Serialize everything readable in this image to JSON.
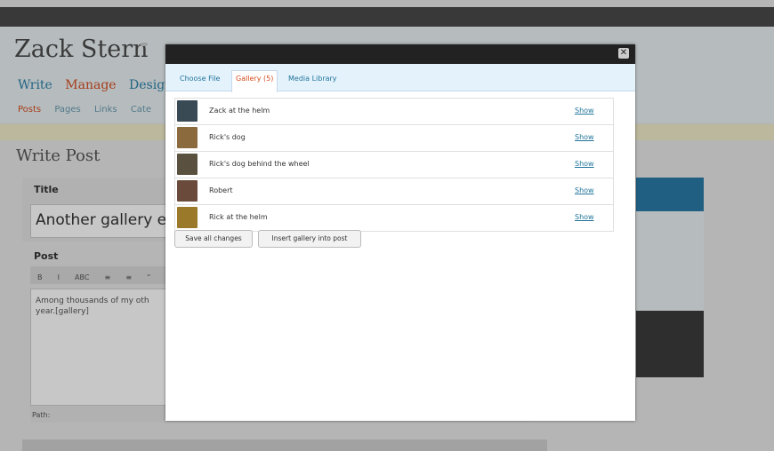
{
  "background": {
    "site_title": "Zack Stern",
    "main_nav": [
      "Write",
      "Manage",
      "Design"
    ],
    "main_nav_current": "Manage",
    "sub_nav": [
      "Posts",
      "Pages",
      "Links",
      "Cate"
    ],
    "page_heading": "Write Post",
    "title_label": "Title",
    "title_value": "Another gallery e",
    "post_label": "Post",
    "editor_text": "Among thousands of my oth year.[gallery]",
    "path_label": "Path:"
  },
  "modal": {
    "tabs": [
      {
        "label": "Choose File",
        "active": false
      },
      {
        "label": "Gallery (5)",
        "active": true
      },
      {
        "label": "Media Library",
        "active": false
      }
    ],
    "gallery": [
      {
        "title": "Zack at the helm",
        "action": "Show",
        "thumb_color": "#3a4a55"
      },
      {
        "title": "Rick's dog",
        "action": "Show",
        "thumb_color": "#8b6a3e"
      },
      {
        "title": "Rick's dog behind the wheel",
        "action": "Show",
        "thumb_color": "#5a5040"
      },
      {
        "title": "Robert",
        "action": "Show",
        "thumb_color": "#6a4a3a"
      },
      {
        "title": "Rick at the helm",
        "action": "Show",
        "thumb_color": "#9a7a2a"
      }
    ],
    "buttons": {
      "save": "Save all changes",
      "insert": "Insert gallery into post"
    }
  },
  "colors": {
    "accent": "#21759b",
    "active_tab": "#d54e21",
    "titlebar": "#222222"
  }
}
